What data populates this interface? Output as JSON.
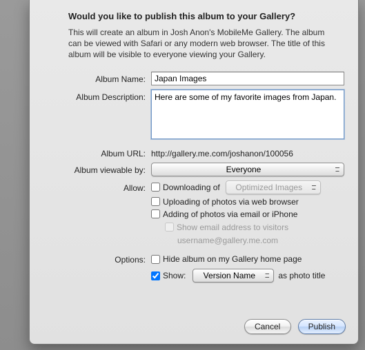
{
  "title": "Would you like to publish this album to your Gallery?",
  "intro": "This will create an album in Josh Anon's MobileMe Gallery. The album can be viewed with Safari or any modern web browser. The title of this album will be visible to everyone viewing your Gallery.",
  "labels": {
    "album_name": "Album Name:",
    "album_description": "Album Description:",
    "album_url": "Album URL:",
    "viewable_by": "Album viewable by:",
    "allow": "Allow:",
    "options": "Options:"
  },
  "values": {
    "album_name": "Japan Images",
    "album_description": "Here are some of my favorite images from Japan.",
    "album_url": "http://gallery.me.com/joshanon/100056",
    "viewable_by_selected": "Everyone",
    "downloading_selected": "Optimized Images",
    "show_selected": "Version Name"
  },
  "allow": {
    "downloading_prefix": "Downloading of",
    "uploading_label": "Uploading of photos via web browser",
    "adding_label": "Adding of photos via email or iPhone",
    "show_email_label": "Show email address to visitors",
    "email_example": "username@gallery.me.com"
  },
  "options": {
    "hide_album_label": "Hide album on my Gallery home page",
    "show_prefix": "Show:",
    "show_suffix": "as photo title"
  },
  "buttons": {
    "cancel": "Cancel",
    "publish": "Publish"
  }
}
